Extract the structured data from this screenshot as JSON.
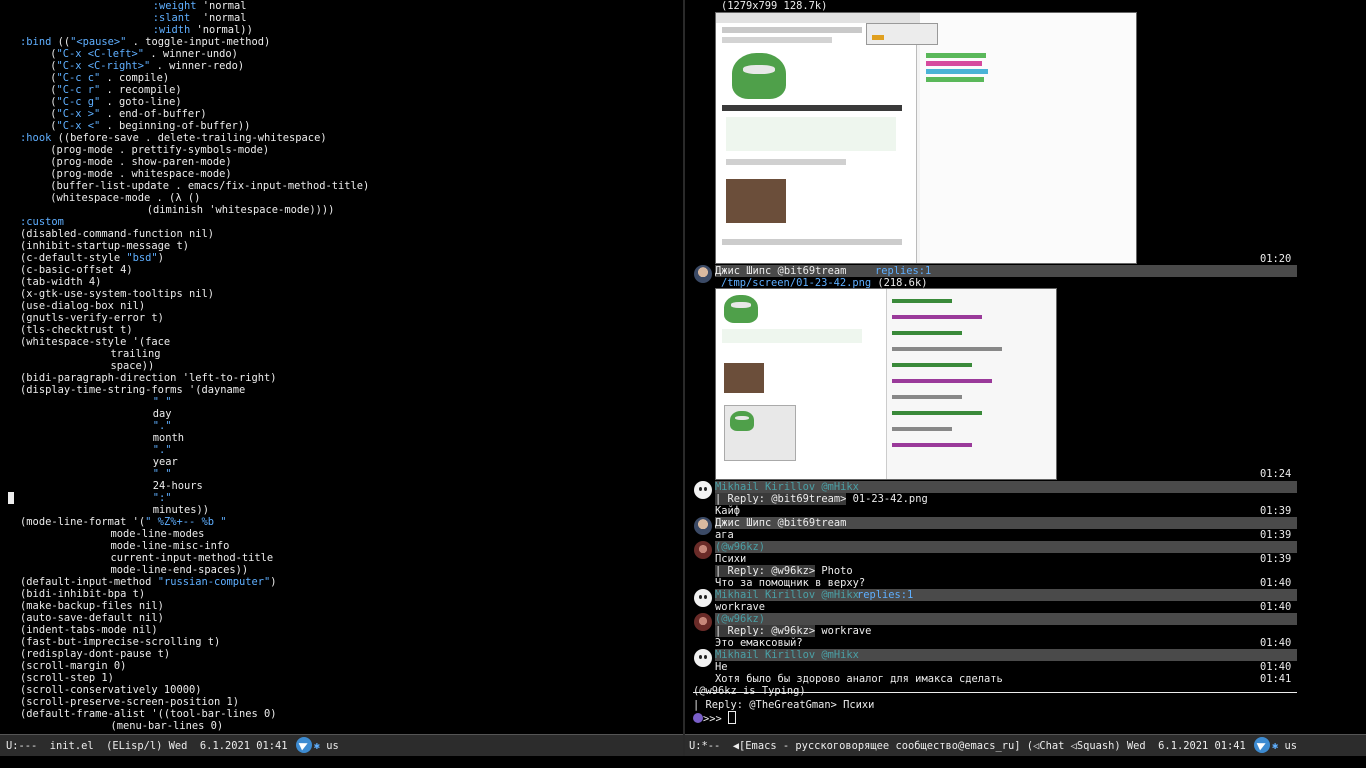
{
  "left_editor": {
    "lines": [
      {
        "i": 24,
        "t": ":weight 'normal"
      },
      {
        "i": 24,
        "t": ":slant  'normal"
      },
      {
        "i": 24,
        "t": ":width 'normal))"
      },
      {
        "i": 2,
        "t": ":bind ((\"<pause>\" . toggle-input-method)"
      },
      {
        "i": 7,
        "t": "(\"C-x <C-left>\" . winner-undo)"
      },
      {
        "i": 7,
        "t": "(\"C-x <C-right>\" . winner-redo)"
      },
      {
        "i": 7,
        "t": "(\"C-c c\" . compile)"
      },
      {
        "i": 7,
        "t": "(\"C-c r\" . recompile)"
      },
      {
        "i": 7,
        "t": "(\"C-c g\" . goto-line)"
      },
      {
        "i": 7,
        "t": "(\"C-x >\" . end-of-buffer)"
      },
      {
        "i": 7,
        "t": "(\"C-x <\" . beginning-of-buffer))"
      },
      {
        "i": 2,
        "t": ":hook ((before-save . delete-trailing-whitespace)"
      },
      {
        "i": 7,
        "t": "(prog-mode . prettify-symbols-mode)"
      },
      {
        "i": 7,
        "t": "(prog-mode . show-paren-mode)"
      },
      {
        "i": 7,
        "t": "(prog-mode . whitespace-mode)"
      },
      {
        "i": 7,
        "t": "(buffer-list-update . emacs/fix-input-method-title)"
      },
      {
        "i": 7,
        "t": "(whitespace-mode . (λ ()"
      },
      {
        "i": 23,
        "t": "(diminish 'whitespace-mode))))"
      },
      {
        "i": 2,
        "t": ":custom"
      },
      {
        "i": 2,
        "t": "(disabled-command-function nil)"
      },
      {
        "i": 2,
        "t": "(inhibit-startup-message t)"
      },
      {
        "i": 2,
        "t": "(c-default-style \"bsd\")"
      },
      {
        "i": 2,
        "t": "(c-basic-offset 4)"
      },
      {
        "i": 2,
        "t": "(tab-width 4)"
      },
      {
        "i": 2,
        "t": "(x-gtk-use-system-tooltips nil)"
      },
      {
        "i": 2,
        "t": "(use-dialog-box nil)"
      },
      {
        "i": 2,
        "t": "(gnutls-verify-error t)"
      },
      {
        "i": 2,
        "t": "(tls-checktrust t)"
      },
      {
        "i": 2,
        "t": "(whitespace-style '(face"
      },
      {
        "i": 17,
        "t": "trailing"
      },
      {
        "i": 17,
        "t": "space))"
      },
      {
        "i": 2,
        "t": "(bidi-paragraph-direction 'left-to-right)"
      },
      {
        "i": 2,
        "t": "(display-time-string-forms '(dayname"
      },
      {
        "i": 24,
        "t": "\" \""
      },
      {
        "i": 24,
        "t": "day"
      },
      {
        "i": 24,
        "t": "\".\""
      },
      {
        "i": 24,
        "t": "month"
      },
      {
        "i": 24,
        "t": "\".\""
      },
      {
        "i": 24,
        "t": "year"
      },
      {
        "i": 24,
        "t": "\" \""
      },
      {
        "i": 24,
        "t": "24-hours"
      },
      {
        "i": 24,
        "t": "\":\""
      },
      {
        "i": 24,
        "t": "minutes))"
      },
      {
        "i": 2,
        "t": "(mode-line-format '(\" %Z%+-- %b \""
      },
      {
        "i": 17,
        "t": "mode-line-modes"
      },
      {
        "i": 17,
        "t": "mode-line-misc-info"
      },
      {
        "i": 17,
        "t": "current-input-method-title"
      },
      {
        "i": 17,
        "t": "mode-line-end-spaces))"
      },
      {
        "i": 2,
        "t": "(default-input-method \"russian-computer\")"
      },
      {
        "i": 2,
        "t": "(bidi-inhibit-bpa t)"
      },
      {
        "i": 2,
        "t": "(make-backup-files nil)"
      },
      {
        "i": 2,
        "t": "(auto-save-default nil)"
      },
      {
        "i": 2,
        "t": "(indent-tabs-mode nil)"
      },
      {
        "i": 2,
        "t": "(fast-but-imprecise-scrolling t)"
      },
      {
        "i": 2,
        "t": "(redisplay-dont-pause t)"
      },
      {
        "i": 2,
        "t": "(scroll-margin 0)"
      },
      {
        "i": 2,
        "t": "(scroll-step 1)"
      },
      {
        "i": 2,
        "t": "(scroll-conservatively 10000)"
      },
      {
        "i": 2,
        "t": "(scroll-preserve-screen-position 1)"
      },
      {
        "i": 2,
        "t": "(default-frame-alist '((tool-bar-lines 0)"
      },
      {
        "i": 17,
        "t": "(menu-bar-lines 0)"
      }
    ]
  },
  "left_modeline": {
    "text": "U:---  init.el  (ELisp/l) Wed  6.1.2021 01:41 ",
    "input_method": "us"
  },
  "chat": {
    "top_image_caption": "(1279x799 128.7k)",
    "top_image_time": "01:20",
    "messages": [
      {
        "name": "Джис Шипс @bit69tream",
        "replies": "replies:1",
        "time": "01:24",
        "link": "/tmp/screen/01-23-42.png",
        "size": "(218.6k)"
      },
      {
        "name": "Mikhail Kirillov @mHikx",
        "reply_to": "| Reply: @bit69tream>",
        "reply_text": " 01-23-42.png",
        "body": "Кайф",
        "time": "01:39"
      },
      {
        "name": "Джис Шипс @bit69tream",
        "body": "ага",
        "time": "01:39"
      },
      {
        "name": "(@w96kz)",
        "body": "Психи",
        "time": "01:39",
        "reply_to": "| Reply: @w96kz>",
        "reply_text": " Photo",
        "body2": "Что за помощник в верху?",
        "time2": "01:40"
      },
      {
        "name": "Mikhail Kirillov @mHikx",
        "replies": "replies:1",
        "body": "workrave",
        "time": "01:40"
      },
      {
        "name": "(@w96kz)",
        "reply_to": "| Reply: @w96kz>",
        "reply_text": " workrave",
        "body": "Это емаксовый?",
        "time": "01:40"
      },
      {
        "name": "Mikhail Kirillov @mHikx",
        "body": "Не",
        "time": "01:40",
        "body2": "Хотя было бы здорово аналог для имакса сделать",
        "time2": "01:41"
      }
    ],
    "typing": "(@w96kz is Typing)",
    "input_reply": "| Reply: @TheGreatGman> Психи",
    "prompt": ">>> "
  },
  "right_modeline": {
    "text": "U:*--  ◀[Emacs - русскоговорящее сообщество@emacs_ru] (◁Chat ◁Squash) Wed  6.1.2021 01:41 ",
    "input_method": "us"
  }
}
